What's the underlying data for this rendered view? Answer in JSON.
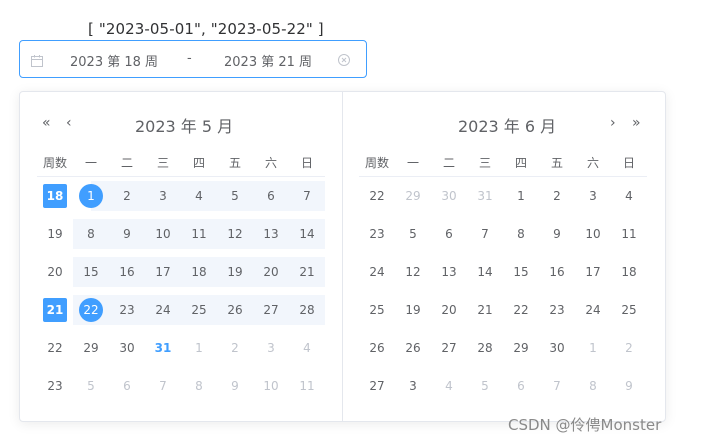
{
  "debug_value": "[ \"2023-05-01\", \"2023-05-22\" ]",
  "range_input": {
    "start": "2023 第 18 周",
    "separator": "-",
    "end": "2023 第 21 周",
    "calendar_icon": "calendar-icon",
    "clear_icon": "circle-close-icon"
  },
  "left_panel": {
    "title": "2023 年 5 月",
    "prev_year": "«",
    "prev_month": "‹",
    "headers": [
      "周数",
      "一",
      "二",
      "三",
      "四",
      "五",
      "六",
      "日"
    ],
    "rows": [
      {
        "week": "18",
        "days": [
          "1",
          "2",
          "3",
          "4",
          "5",
          "6",
          "7"
        ]
      },
      {
        "week": "19",
        "days": [
          "8",
          "9",
          "10",
          "11",
          "12",
          "13",
          "14"
        ]
      },
      {
        "week": "20",
        "days": [
          "15",
          "16",
          "17",
          "18",
          "19",
          "20",
          "21"
        ]
      },
      {
        "week": "21",
        "days": [
          "22",
          "23",
          "24",
          "25",
          "26",
          "27",
          "28"
        ]
      },
      {
        "week": "22",
        "days": [
          "29",
          "30",
          "31",
          "1",
          "2",
          "3",
          "4"
        ]
      },
      {
        "week": "23",
        "days": [
          "5",
          "6",
          "7",
          "8",
          "9",
          "10",
          "11"
        ]
      }
    ]
  },
  "right_panel": {
    "title": "2023 年 6 月",
    "next_month": "›",
    "next_year": "»",
    "headers": [
      "周数",
      "一",
      "二",
      "三",
      "四",
      "五",
      "六",
      "日"
    ],
    "rows": [
      {
        "week": "22",
        "days": [
          "29",
          "30",
          "31",
          "1",
          "2",
          "3",
          "4"
        ]
      },
      {
        "week": "23",
        "days": [
          "5",
          "6",
          "7",
          "8",
          "9",
          "10",
          "11"
        ]
      },
      {
        "week": "24",
        "days": [
          "12",
          "13",
          "14",
          "15",
          "16",
          "17",
          "18"
        ]
      },
      {
        "week": "25",
        "days": [
          "19",
          "20",
          "21",
          "22",
          "23",
          "24",
          "25"
        ]
      },
      {
        "week": "26",
        "days": [
          "26",
          "27",
          "28",
          "29",
          "30",
          "1",
          "2"
        ]
      },
      {
        "week": "27",
        "days": [
          "3",
          "4",
          "5",
          "6",
          "7",
          "8",
          "9"
        ]
      }
    ]
  },
  "colors": {
    "accent": "#409eff",
    "range_bg": "#f2f6fc",
    "muted": "#c0c4cc"
  },
  "watermark": "CSDN @伶俜Monster"
}
